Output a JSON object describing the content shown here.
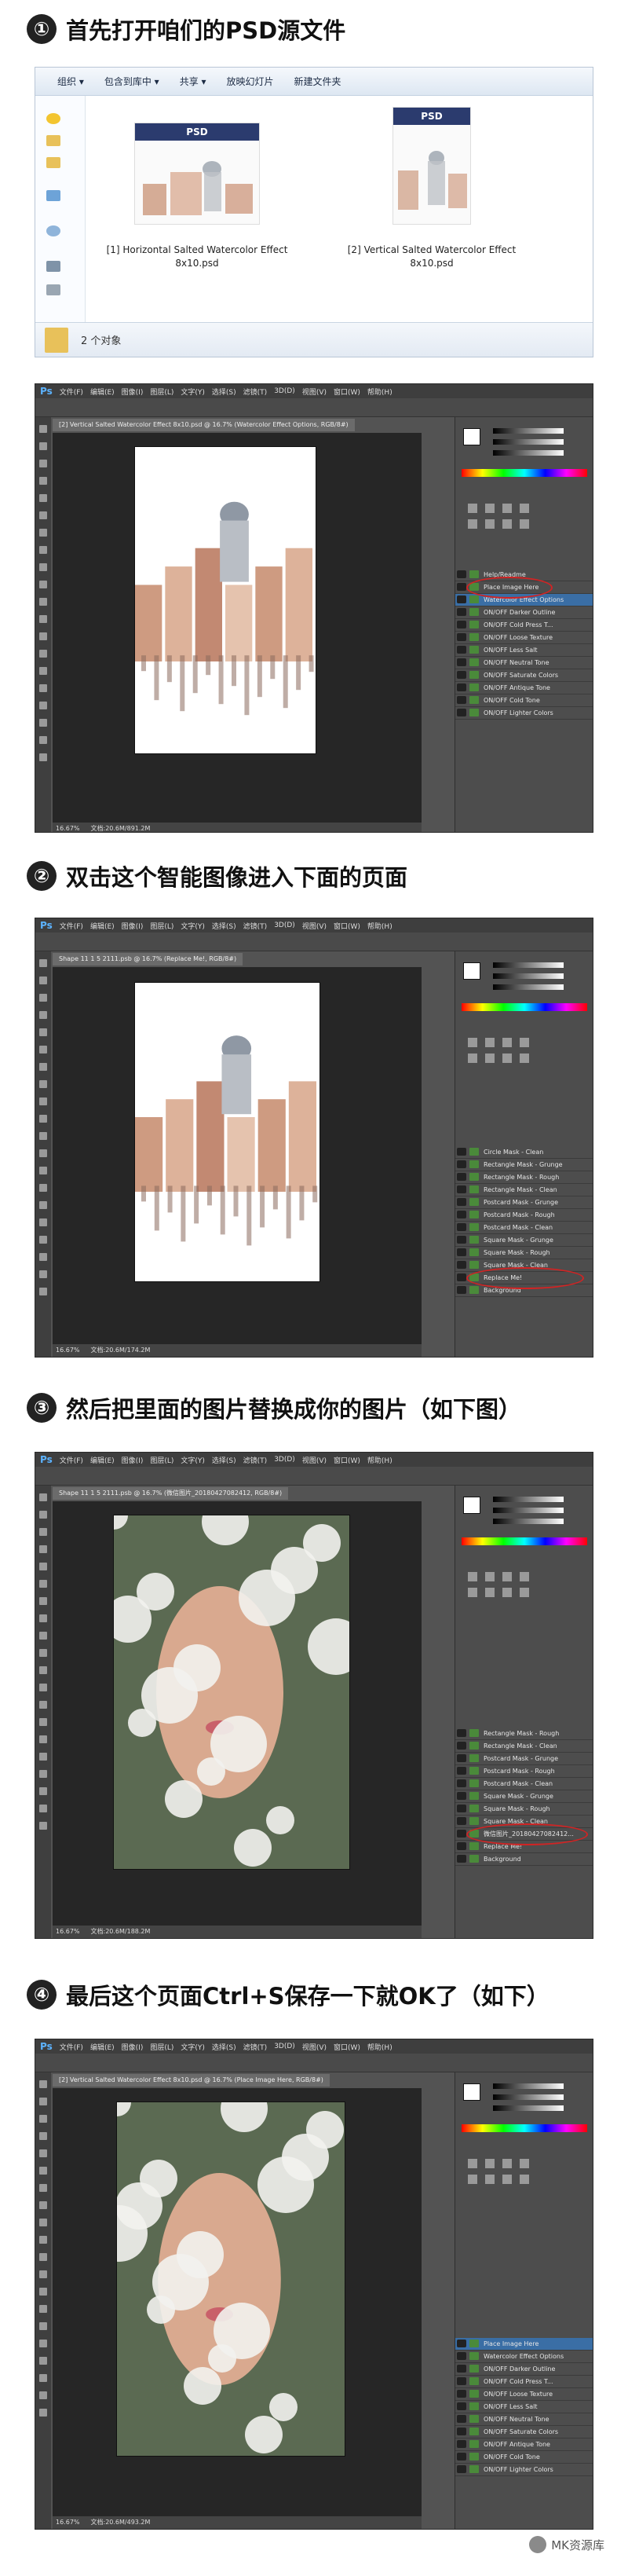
{
  "steps": [
    {
      "num": "①",
      "title": "首先打开咱们的PSD源文件"
    },
    {
      "num": "②",
      "title": "双击这个智能图像进入下面的页面"
    },
    {
      "num": "③",
      "title": "然后把里面的图片替换成你的图片（如下图）"
    },
    {
      "num": "④",
      "title": "最后这个页面Ctrl+S保存一下就OK了（如下）"
    }
  ],
  "explorer": {
    "toolbar": [
      "组织 ▾",
      "包含到库中 ▾",
      "共享 ▾",
      "放映幻灯片",
      "新建文件夹"
    ],
    "thumb_label": "PSD",
    "files": [
      {
        "name": "[1] Horizontal Salted Watercolor Effect",
        "size": "8x10.psd"
      },
      {
        "name": "[2] Vertical Salted Watercolor Effect",
        "size": "8x10.psd"
      }
    ],
    "status": "2 个对象"
  },
  "ps_menu": [
    "文件(F)",
    "编辑(E)",
    "图像(I)",
    "图层(L)",
    "文字(Y)",
    "选择(S)",
    "滤镜(T)",
    "3D(D)",
    "视图(V)",
    "窗口(W)",
    "帮助(H)"
  ],
  "ps_logo": "Ps",
  "windows": [
    {
      "tab": "[2] Vertical Salted Watercolor Effect 8x10.psd @ 16.7% (Watercolor Effect Options, RGB/8#)",
      "status": {
        "zoom": "16.67%",
        "doc": "文档:20.6M/891.2M"
      },
      "layers": [
        {
          "name": "Help/Readme",
          "sel": false
        },
        {
          "name": "Place Image Here",
          "sel": false
        },
        {
          "name": "Watercolor Effect Options",
          "sel": true
        },
        {
          "name": "ON/OFF Darker Outline",
          "sel": false
        },
        {
          "name": "ON/OFF Cold Press T...",
          "sel": false
        },
        {
          "name": "ON/OFF Loose Texture",
          "sel": false
        },
        {
          "name": "ON/OFF Less Salt",
          "sel": false
        },
        {
          "name": "ON/OFF Neutral Tone",
          "sel": false
        },
        {
          "name": "ON/OFF Saturate Colors",
          "sel": false
        },
        {
          "name": "ON/OFF Antique Tone",
          "sel": false
        },
        {
          "name": "ON/OFF Cold Tone",
          "sel": false
        },
        {
          "name": "ON/OFF Lighter Colors",
          "sel": false
        }
      ]
    },
    {
      "tab": "Shape 11 1 5 2111.psb @ 16.7% (Replace Me!, RGB/8#)",
      "status": {
        "zoom": "16.67%",
        "doc": "文档:20.6M/174.2M"
      },
      "layers": [
        {
          "name": "Circle Mask - Clean",
          "sel": false
        },
        {
          "name": "Rectangle Mask - Grunge",
          "sel": false
        },
        {
          "name": "Rectangle Mask - Rough",
          "sel": false
        },
        {
          "name": "Rectangle Mask - Clean",
          "sel": false
        },
        {
          "name": "Postcard Mask - Grunge",
          "sel": false
        },
        {
          "name": "Postcard Mask - Rough",
          "sel": false
        },
        {
          "name": "Postcard Mask - Clean",
          "sel": false
        },
        {
          "name": "Square Mask - Grunge",
          "sel": false
        },
        {
          "name": "Square Mask - Rough",
          "sel": false
        },
        {
          "name": "Square Mask - Clean",
          "sel": false
        },
        {
          "name": "Replace Me!",
          "sel": false
        },
        {
          "name": "Background",
          "sel": false
        }
      ]
    },
    {
      "tab": "Shape 11 1 5 2111.psb @ 16.7% (微信图片_20180427082412, RGB/8#)",
      "status": {
        "zoom": "16.67%",
        "doc": "文档:20.6M/188.2M"
      },
      "layers": [
        {
          "name": "Rectangle Mask - Rough",
          "sel": false
        },
        {
          "name": "Rectangle Mask - Clean",
          "sel": false
        },
        {
          "name": "Postcard Mask - Grunge",
          "sel": false
        },
        {
          "name": "Postcard Mask - Rough",
          "sel": false
        },
        {
          "name": "Postcard Mask - Clean",
          "sel": false
        },
        {
          "name": "Square Mask - Grunge",
          "sel": false
        },
        {
          "name": "Square Mask - Rough",
          "sel": false
        },
        {
          "name": "Square Mask - Clean",
          "sel": false
        },
        {
          "name": "微信图片_20180427082412...",
          "sel": false
        },
        {
          "name": "Replace Me!",
          "sel": false
        },
        {
          "name": "Background",
          "sel": false
        }
      ]
    },
    {
      "tab": "[2] Vertical Salted Watercolor Effect 8x10.psd @ 16.7% (Place Image Here, RGB/8#)",
      "status": {
        "zoom": "16.67%",
        "doc": "文档:20.6M/493.2M"
      },
      "layers": [
        {
          "name": "Place Image Here",
          "sel": true
        },
        {
          "name": "Watercolor Effect Options",
          "sel": false
        },
        {
          "name": "ON/OFF Darker Outline",
          "sel": false
        },
        {
          "name": "ON/OFF Cold Press T...",
          "sel": false
        },
        {
          "name": "ON/OFF Loose Texture",
          "sel": false
        },
        {
          "name": "ON/OFF Less Salt",
          "sel": false
        },
        {
          "name": "ON/OFF Neutral Tone",
          "sel": false
        },
        {
          "name": "ON/OFF Saturate Colors",
          "sel": false
        },
        {
          "name": "ON/OFF Antique Tone",
          "sel": false
        },
        {
          "name": "ON/OFF Cold Tone",
          "sel": false
        },
        {
          "name": "ON/OFF Lighter Colors",
          "sel": false
        }
      ]
    }
  ],
  "watermark": "MK资源库"
}
